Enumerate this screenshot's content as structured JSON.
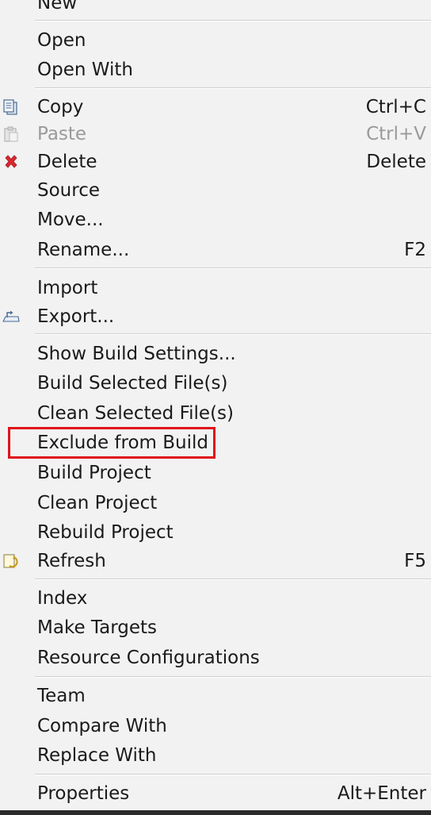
{
  "menu": {
    "items": [
      {
        "label": "New",
        "shortcut": ""
      },
      {
        "label": "Open",
        "shortcut": ""
      },
      {
        "label": "Open With",
        "shortcut": ""
      },
      {
        "label": "Copy",
        "shortcut": "Ctrl+C",
        "icon": "copy-icon"
      },
      {
        "label": "Paste",
        "shortcut": "Ctrl+V",
        "icon": "paste-icon",
        "disabled": true
      },
      {
        "label": "Delete",
        "shortcut": "Delete",
        "icon": "delete-icon"
      },
      {
        "label": "Source",
        "shortcut": ""
      },
      {
        "label": "Move...",
        "shortcut": ""
      },
      {
        "label": "Rename...",
        "shortcut": "F2"
      },
      {
        "label": "Import",
        "shortcut": ""
      },
      {
        "label": "Export...",
        "shortcut": "",
        "icon": "export-icon"
      },
      {
        "label": "Show Build Settings...",
        "shortcut": ""
      },
      {
        "label": "Build Selected File(s)",
        "shortcut": ""
      },
      {
        "label": "Clean Selected File(s)",
        "shortcut": ""
      },
      {
        "label": "Exclude from Build",
        "shortcut": "",
        "highlighted": true
      },
      {
        "label": "Build Project",
        "shortcut": ""
      },
      {
        "label": "Clean Project",
        "shortcut": ""
      },
      {
        "label": "Rebuild Project",
        "shortcut": ""
      },
      {
        "label": "Refresh",
        "shortcut": "F5",
        "icon": "refresh-icon"
      },
      {
        "label": "Index",
        "shortcut": ""
      },
      {
        "label": "Make Targets",
        "shortcut": ""
      },
      {
        "label": "Resource Configurations",
        "shortcut": ""
      },
      {
        "label": "Team",
        "shortcut": ""
      },
      {
        "label": "Compare With",
        "shortcut": ""
      },
      {
        "label": "Replace With",
        "shortcut": ""
      },
      {
        "label": "Properties",
        "shortcut": "Alt+Enter"
      }
    ]
  },
  "colors": {
    "highlight_border": "#e0121b",
    "disabled_text": "#9a9a9a",
    "delete_icon": "#d8292f"
  }
}
